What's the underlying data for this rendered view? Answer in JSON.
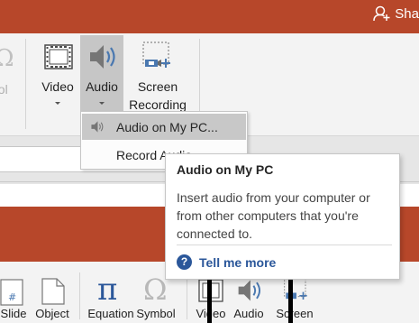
{
  "title_bar": {
    "user_label": "Sha"
  },
  "ribbon": {
    "partial_left_label": "ool",
    "buttons": [
      {
        "id": "video",
        "label": "Video"
      },
      {
        "id": "audio",
        "label": "Audio"
      },
      {
        "id": "screen_recording",
        "label_line1": "Screen",
        "label_line2": "Recording"
      }
    ]
  },
  "audio_menu": {
    "items": [
      {
        "label": "Audio on My PC...",
        "highlighted": true
      },
      {
        "label": "Record Audio..."
      }
    ]
  },
  "tooltip": {
    "title": "Audio on My PC",
    "description": "Insert audio from your computer or from other computers that you're connected to.",
    "link": "Tell me more"
  },
  "lower_ribbon": {
    "labels": {
      "slide": "Slide",
      "object": "Object",
      "equation": "Equation",
      "symbol": "Symbol",
      "video": "Video",
      "audio": "Audio",
      "screen": "Screen"
    }
  },
  "colors": {
    "title_bar": "#b7472a",
    "ribbon": "#f3f3f3",
    "pressed": "#c6c6c6",
    "link": "#2b579a",
    "equation_pi": "#2b579a"
  }
}
